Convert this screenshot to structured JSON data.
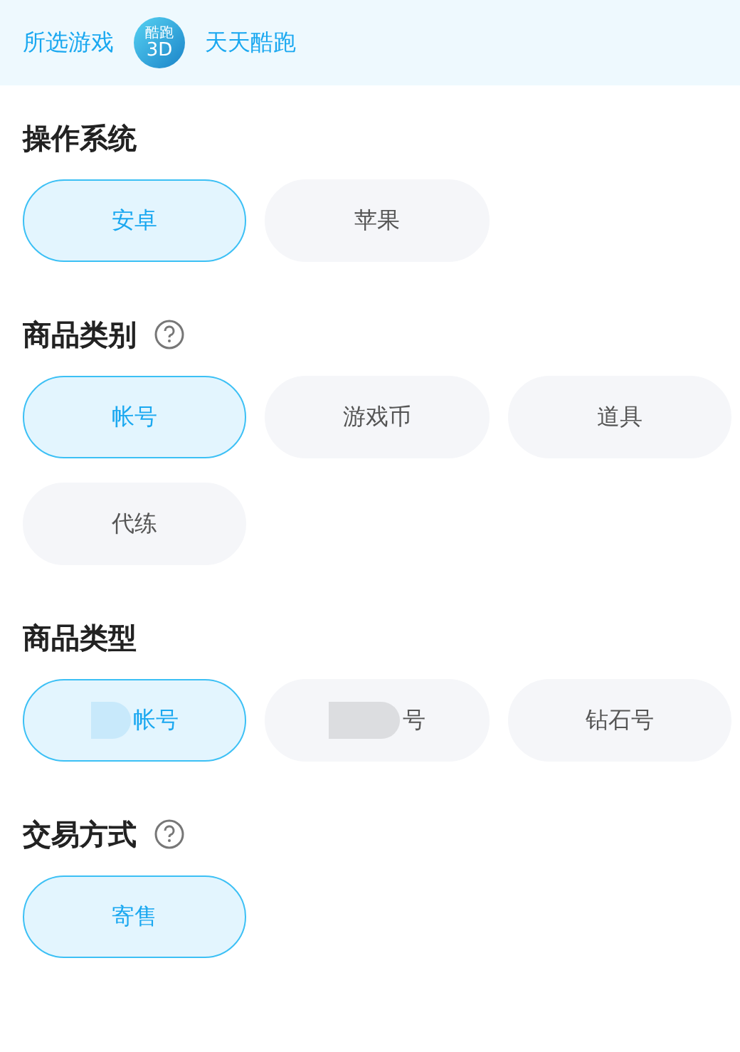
{
  "header": {
    "label": "所选游戏",
    "game_icon": {
      "line1": "酷跑",
      "line2": "3D"
    },
    "game_name": "天天酷跑"
  },
  "sections": [
    {
      "title": "操作系统",
      "help": false,
      "options": [
        {
          "label": "安卓",
          "selected": true
        },
        {
          "label": "苹果",
          "selected": false
        }
      ]
    },
    {
      "title": "商品类别",
      "help": true,
      "options": [
        {
          "label": "帐号",
          "selected": true
        },
        {
          "label": "游戏币",
          "selected": false
        },
        {
          "label": "道具",
          "selected": false
        },
        {
          "label": "代练",
          "selected": false
        }
      ]
    },
    {
      "title": "商品类型",
      "help": false,
      "options": [
        {
          "label": "帐号",
          "selected": true,
          "redacted": true
        },
        {
          "label": "号",
          "selected": false,
          "redacted": true
        },
        {
          "label": "钻石号",
          "selected": false,
          "redacted": false
        }
      ]
    },
    {
      "title": "交易方式",
      "help": true,
      "options": [
        {
          "label": "寄售",
          "selected": true
        }
      ]
    }
  ]
}
